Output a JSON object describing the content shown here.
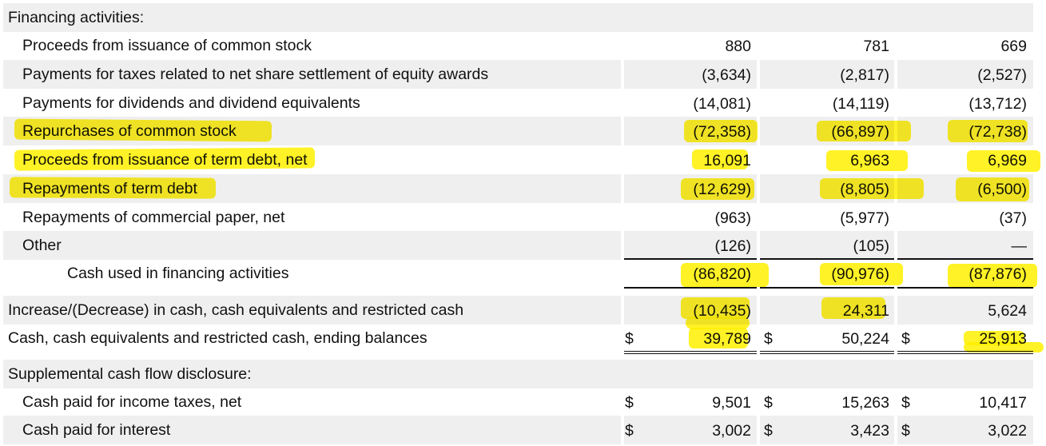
{
  "sections": {
    "financing_title": "Financing activities:",
    "supplemental_title": "Supplemental cash flow disclosure:"
  },
  "currency_symbol": "$",
  "rows": [
    {
      "label": "Proceeds from issuance of common stock",
      "c1": "880",
      "c2": "781",
      "c3": "669"
    },
    {
      "label": "Payments for taxes related to net share settlement of equity awards",
      "c1": "(3,634)",
      "c2": "(2,817)",
      "c3": "(2,527)"
    },
    {
      "label": "Payments for dividends and dividend equivalents",
      "c1": "(14,081)",
      "c2": "(14,119)",
      "c3": "(13,712)"
    },
    {
      "label": "Repurchases of common stock",
      "c1": "(72,358)",
      "c2": "(66,897)",
      "c3": "(72,738)"
    },
    {
      "label": "Proceeds from issuance of term debt, net",
      "c1": "16,091",
      "c2": "6,963",
      "c3": "6,969"
    },
    {
      "label": "Repayments of term debt",
      "c1": "(12,629)",
      "c2": "(8,805)",
      "c3": "(6,500)"
    },
    {
      "label": "Repayments of commercial paper, net",
      "c1": "(963)",
      "c2": "(5,977)",
      "c3": "(37)"
    },
    {
      "label": "Other",
      "c1": "(126)",
      "c2": "(105)",
      "c3": "—"
    },
    {
      "label": "Cash used in financing activities",
      "c1": "(86,820)",
      "c2": "(90,976)",
      "c3": "(87,876)"
    },
    {
      "label": "Increase/(Decrease) in cash, cash equivalents and restricted cash",
      "c1": "(10,435)",
      "c2": "24,311",
      "c3": "5,624"
    },
    {
      "label": "Cash, cash equivalents and restricted cash, ending balances",
      "c1": "39,789",
      "c2": "50,224",
      "c3": "25,913"
    },
    {
      "label": "Cash paid for income taxes, net",
      "c1": "9,501",
      "c2": "15,263",
      "c3": "10,417"
    },
    {
      "label": "Cash paid for interest",
      "c1": "3,002",
      "c2": "3,423",
      "c3": "3,022"
    }
  ],
  "highlight_color": "#fff000"
}
